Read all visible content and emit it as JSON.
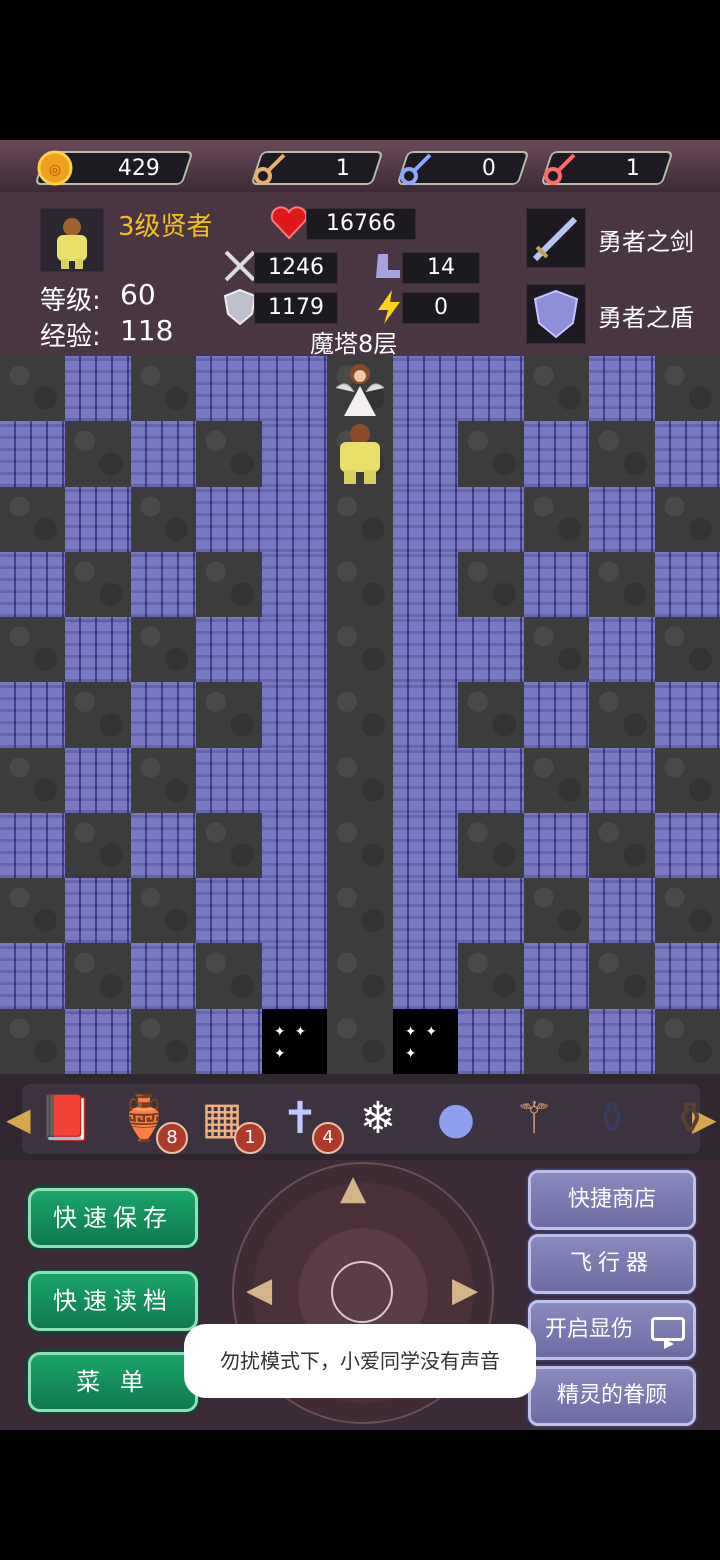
{
  "resources": {
    "gold": "429",
    "yellow_key": "1",
    "blue_key": "0",
    "red_key": "1"
  },
  "hero": {
    "title": "3级贤者",
    "level_label": "等级:",
    "level_value": "60",
    "exp_label": "经验:",
    "exp_value": "118",
    "hp": "16766",
    "attack": "1246",
    "defense": "1179",
    "magic_defense": "14",
    "speed": "0"
  },
  "equipment": {
    "weapon": "勇者之剑",
    "armor": "勇者之盾"
  },
  "floor": "魔塔8层",
  "items": [
    {
      "name": "monster-book-icon",
      "glyph": "📕",
      "count": ""
    },
    {
      "name": "green-potion-icon",
      "glyph": "🏺",
      "count": "8"
    },
    {
      "name": "floor-teleport-icon",
      "glyph": "▦",
      "count": "1"
    },
    {
      "name": "holy-cross-icon",
      "glyph": "✝",
      "count": "4"
    },
    {
      "name": "snowflake-icon",
      "glyph": "❄",
      "count": ""
    },
    {
      "name": "magic-orb-icon",
      "glyph": "●",
      "count": ""
    },
    {
      "name": "wand-icon",
      "glyph": "⚚",
      "count": ""
    },
    {
      "name": "dark-potion-icon",
      "glyph": "⚱",
      "count": ""
    },
    {
      "name": "bag-icon",
      "glyph": "⚱",
      "count": ""
    }
  ],
  "buttons": {
    "quick_save": "快速保存",
    "quick_load": "快速读档",
    "menu": "菜 单",
    "quick_shop": "快捷商店",
    "flyer": "飞行器",
    "show_damage": "开启显伤",
    "fairy": "精灵的眷顾"
  },
  "toast": "勿扰模式下，小爱同学没有声音",
  "colors": {
    "title_gold": "#f0c020",
    "green_button": "#16955f",
    "purple_button": "#7a7ab2"
  }
}
